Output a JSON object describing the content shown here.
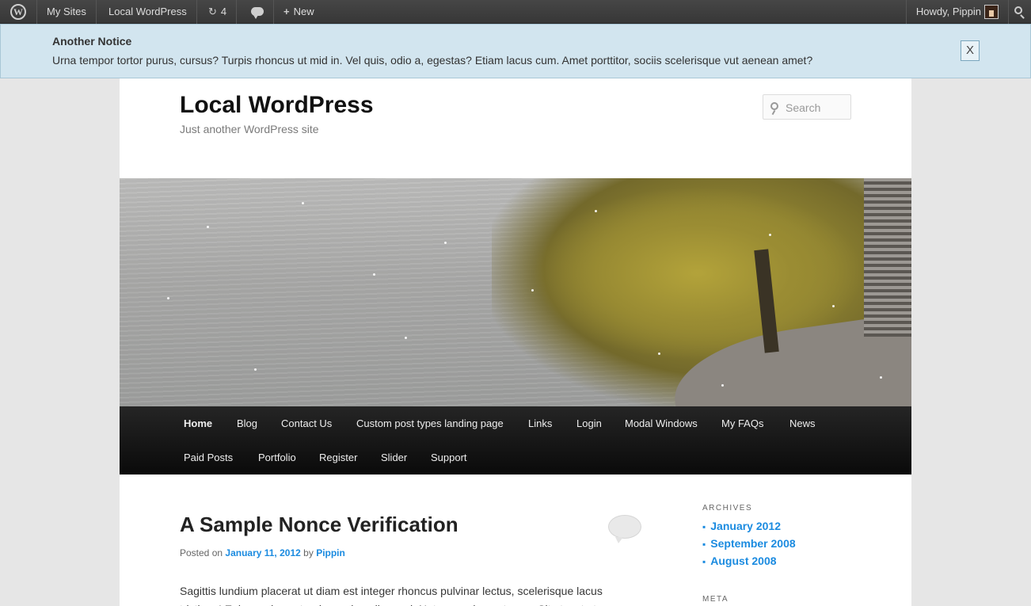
{
  "adminbar": {
    "wp_logo_icon": "wordpress-logo-icon",
    "my_sites": "My Sites",
    "site_name": "Local WordPress",
    "updates_count": "4",
    "new_label": "New",
    "howdy": "Howdy, Pippin"
  },
  "notice": {
    "title": "Another Notice",
    "text": "Urna tempor tortor purus, cursus? Turpis rhoncus ut mid in. Vel quis, odio a, egestas? Etiam lacus cum. Amet porttitor, sociis scelerisque vut aenean amet?",
    "close_label": "X"
  },
  "site": {
    "title": "Local WordPress",
    "description": "Just another WordPress site",
    "search_placeholder": "Search"
  },
  "nav": {
    "row1": [
      "Home",
      "Blog",
      "Contact Us",
      "Custom post types landing page",
      "Links",
      "Login",
      "Modal Windows",
      "My FAQs",
      "News"
    ],
    "row2": [
      "Paid Posts",
      "Portfolio",
      "Register",
      "Slider",
      "Support"
    ]
  },
  "post": {
    "title": "A Sample Nonce Verification",
    "posted_on": "Posted on",
    "date": "January 11, 2012",
    "by": "by",
    "author": "Pippin",
    "excerpt": "Sagittis lundium placerat ut diam est integer rhoncus pulvinar lectus, scelerisque lacus tristique! Enim, ac lacus turpis ac phasellus sed. Natoque, placerat urna. Sit ut, est ut"
  },
  "sidebar": {
    "archives_title": "ARCHIVES",
    "archives": [
      "January 2012",
      "September 2008",
      "August 2008"
    ],
    "meta_title": "META"
  },
  "colors": {
    "link": "#1b8be0",
    "notice_bg": "#d2e5ef",
    "adminbar_bg": "#464646",
    "nav_bg": "#111111"
  }
}
